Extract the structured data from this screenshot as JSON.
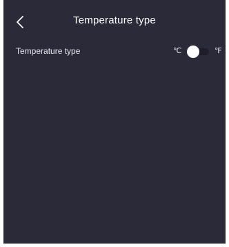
{
  "header": {
    "title": "Temperature type",
    "back_icon": "chevron-left-icon"
  },
  "setting": {
    "label": "Temperature type",
    "unit_left": "℃",
    "unit_right": "℉",
    "selected_unit": "℃"
  },
  "colors": {
    "background": "#2b2a38",
    "text": "#ffffff",
    "toggle_knob": "#ffffff",
    "toggle_track": "#1e1d29"
  }
}
